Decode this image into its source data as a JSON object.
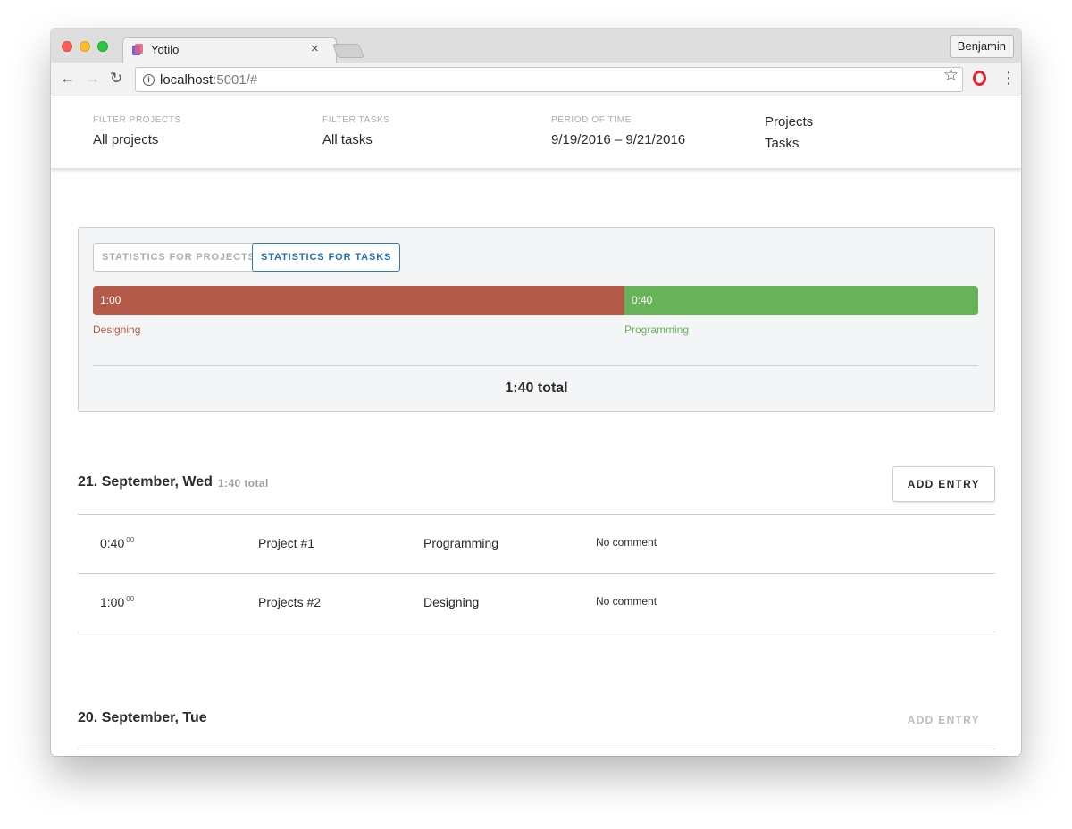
{
  "browser": {
    "tab_title": "Yotilo",
    "tab_close": "×",
    "profile": "Benjamin",
    "url_host": "localhost",
    "url_rest": ":5001/#",
    "icons": {
      "back": "arrow-left-icon",
      "forward": "arrow-right-icon",
      "reload": "reload-icon",
      "info": "info-icon",
      "star": "star-icon",
      "opera": "opera-icon",
      "menu": "kebab-menu-icon"
    }
  },
  "filters": {
    "projects_label": "FILTER PROJECTS",
    "projects_value": "All projects",
    "tasks_label": "FILTER TASKS",
    "tasks_value": "All tasks",
    "period_label": "PERIOD OF TIME",
    "period_value": "9/19/2016 – 9/21/2016",
    "view_projects": "Projects",
    "view_tasks": "Tasks"
  },
  "stats": {
    "tab_projects": "STATISTICS FOR PROJECTS",
    "tab_tasks": "STATISTICS FOR TASKS",
    "active_tab": "tasks",
    "segments": [
      {
        "label": "Designing",
        "value": "1:00",
        "minutes": 60,
        "color": "#b55a49"
      },
      {
        "label": "Programming",
        "value": "0:40",
        "minutes": 40,
        "color": "#68b25a"
      }
    ],
    "total": "1:40 total"
  },
  "days": [
    {
      "title": "21. September, Wed",
      "total": "1:40 total",
      "add_label": "ADD ENTRY",
      "entries": [
        {
          "duration": "0:40",
          "seconds": "00",
          "project": "Project #1",
          "task": "Programming",
          "comment": "No comment"
        },
        {
          "duration": "1:00",
          "seconds": "00",
          "project": "Projects #2",
          "task": "Designing",
          "comment": "No comment"
        }
      ]
    },
    {
      "title": "20. September, Tue",
      "add_label": "ADD ENTRY"
    }
  ]
}
